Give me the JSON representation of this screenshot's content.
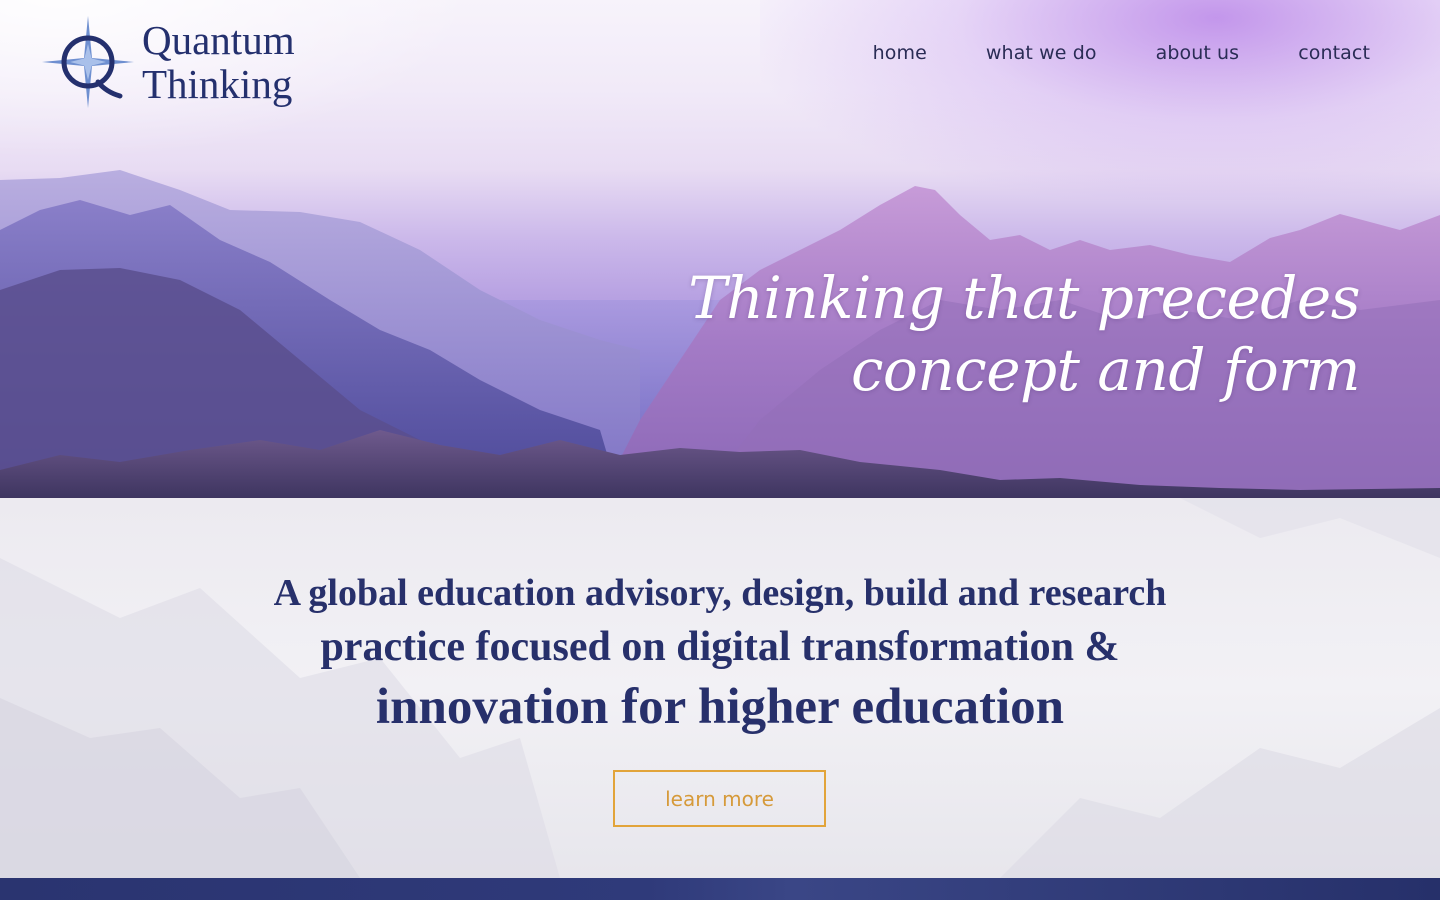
{
  "brand": {
    "name_line1": "Quantum",
    "name_line2": "Thinking",
    "logo_letter": "Q",
    "color_primary": "#24306e"
  },
  "nav": {
    "items": [
      {
        "label": "home"
      },
      {
        "label": "what we do"
      },
      {
        "label": "about us"
      },
      {
        "label": "contact"
      }
    ]
  },
  "hero": {
    "tagline_line1": "Thinking that precedes",
    "tagline_line2": "concept and form"
  },
  "intro": {
    "line1": "A global education advisory, design, build and research",
    "line2": "practice focused on digital transformation &",
    "line3": "innovation for higher education",
    "cta_label": "learn more",
    "cta_color": "#e2a43a"
  }
}
